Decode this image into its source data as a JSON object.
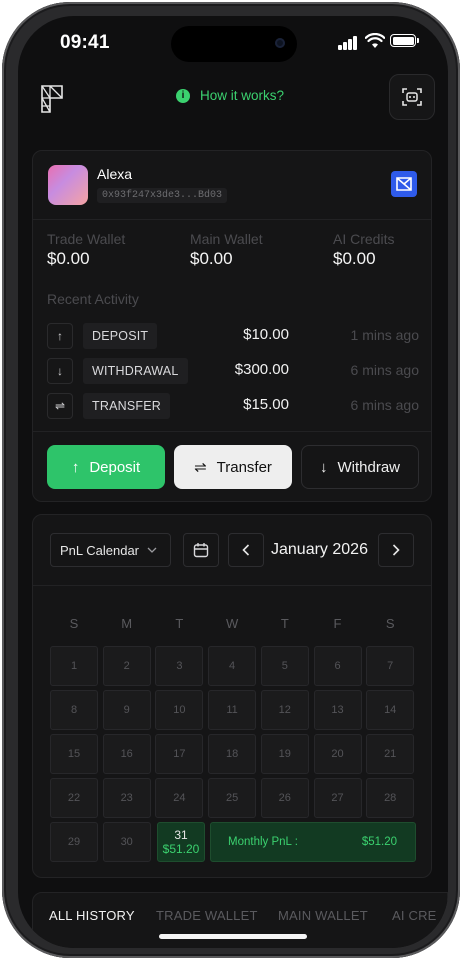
{
  "status": {
    "time": "09:41"
  },
  "header": {
    "help_label": "How it works?"
  },
  "user": {
    "name": "Alexa",
    "address": "0x93f247x3de3...Bd03"
  },
  "balances": [
    {
      "label": "Trade Wallet",
      "value": "$0.00"
    },
    {
      "label": "Main Wallet",
      "value": "$0.00"
    },
    {
      "label": "AI Credits",
      "value": "$0.00"
    }
  ],
  "recent": {
    "title": "Recent Activity",
    "items": [
      {
        "icon": "arrow-up-icon",
        "type": "DEPOSIT",
        "amount": "$10.00",
        "ago": "1 mins ago"
      },
      {
        "icon": "arrow-down-icon",
        "type": "WITHDRAWAL",
        "amount": "$300.00",
        "ago": "6 mins ago"
      },
      {
        "icon": "swap-icon",
        "type": "TRANSFER",
        "amount": "$15.00",
        "ago": "6 mins ago"
      }
    ]
  },
  "actions": {
    "deposit": "Deposit",
    "transfer": "Transfer",
    "withdraw": "Withdraw"
  },
  "calendar": {
    "selector": "PnL Calendar",
    "month": "January 2026",
    "weekdays": [
      "S",
      "M",
      "T",
      "W",
      "T",
      "F",
      "S"
    ],
    "days": [
      "1",
      "2",
      "3",
      "4",
      "5",
      "6",
      "7",
      "8",
      "9",
      "10",
      "11",
      "12",
      "13",
      "14",
      "15",
      "16",
      "17",
      "18",
      "19",
      "20",
      "21",
      "22",
      "23",
      "24",
      "25",
      "26",
      "27",
      "28",
      "29",
      "30"
    ],
    "active_day": "31",
    "active_pnl": "$51.20",
    "monthly_label": "Monthly PnL :",
    "monthly_value": "$51.20"
  },
  "history_tabs": [
    "ALL HISTORY",
    "TRADE WALLET",
    "MAIN WALLET",
    "AI CRE"
  ],
  "colors": {
    "accent": "#2ec46a",
    "brand": "#2f5bea",
    "background": "#0f0f10"
  }
}
